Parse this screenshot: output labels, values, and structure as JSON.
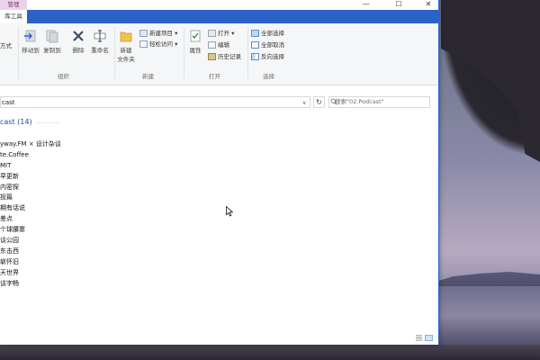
{
  "window": {
    "context_tab": "管理",
    "ribbon_tab": "库工具",
    "controls": {
      "minimize": "—",
      "maximize": "☐",
      "close": "✕"
    }
  },
  "ribbon": {
    "partial_left_label": "方式",
    "organize": {
      "label": "组织",
      "move_to": "移动到",
      "copy_to": "复制到",
      "delete": "删除",
      "rename": "重命名"
    },
    "new": {
      "label": "新建",
      "new_folder": "新建\n文件夹",
      "new_item": "新建项目",
      "easy_access": "轻松访问"
    },
    "open": {
      "label": "打开",
      "properties": "属性",
      "open": "打开",
      "edit": "编辑",
      "history": "历史记录"
    },
    "select": {
      "label": "选择",
      "select_all": "全部选择",
      "select_none": "全部取消",
      "invert": "反向选择"
    }
  },
  "address": {
    "path": "cast",
    "search_placeholder": "搜索\"02.Podcast\""
  },
  "content": {
    "group_header": "cast (14)",
    "items": [
      "yway.FM × 设计杂谈",
      "te.Coffee",
      "MIT",
      "早更新",
      "内密探",
      "投篇",
      "期有话说",
      "差点",
      "个球腰寨",
      "谈公园",
      "东击西",
      "崭怀旧",
      "天世界",
      "谈字畅"
    ]
  },
  "colors": {
    "accent": "#2a62c8",
    "context_tab_bg": "#ead3e9",
    "group_header": "#1e4e9a"
  },
  "icons": [
    "move-to-icon",
    "copy-to-icon",
    "delete-icon",
    "rename-icon",
    "new-folder-icon",
    "properties-icon",
    "select-all-icon",
    "search-icon",
    "refresh-icon"
  ]
}
